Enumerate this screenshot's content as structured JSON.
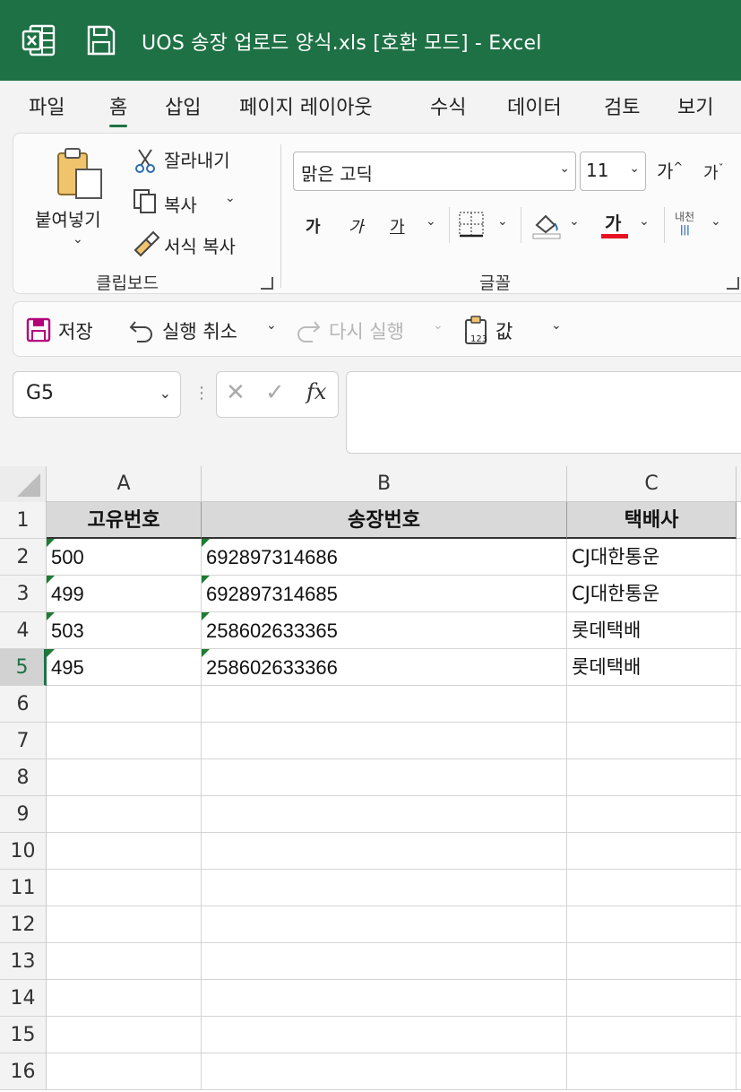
{
  "titlebar": {
    "title": "UOS 송장 업로드 양식.xls  [호환 모드]  -  Excel",
    "bg_color": "#1e7145"
  },
  "menu": {
    "tabs": [
      {
        "label": "파일"
      },
      {
        "label": "홈",
        "active": true
      },
      {
        "label": "삽입"
      },
      {
        "label": "페이지 레이아웃"
      },
      {
        "label": "수식"
      },
      {
        "label": "데이터"
      },
      {
        "label": "검토"
      },
      {
        "label": "보기"
      }
    ]
  },
  "ribbon": {
    "clipboard": {
      "paste_label": "붙여넣기",
      "cut_label": "잘라내기",
      "copy_label": "복사",
      "format_painter_label": "서식 복사",
      "group_label": "클립보드"
    },
    "font": {
      "font_name": "맑은 고딕",
      "font_size": "11",
      "grow_label": "가",
      "shrink_label": "가",
      "bold_label": "가",
      "italic_label": "가",
      "underline_label": "가",
      "font_color_label": "가",
      "phonetic_label": "내천",
      "group_label": "글꼴",
      "font_color": "#e81123"
    }
  },
  "qat": {
    "save_label": "저장",
    "undo_label": "실행 취소",
    "redo_label": "다시 실행",
    "paste_values_label": "값"
  },
  "formula_bar": {
    "name_box": "G5",
    "formula": ""
  },
  "sheet": {
    "columns": [
      "A",
      "B",
      "C"
    ],
    "row_numbers": [
      "1",
      "2",
      "3",
      "4",
      "5",
      "6",
      "7",
      "8",
      "9",
      "10",
      "11",
      "12",
      "13",
      "14",
      "15",
      "16"
    ],
    "selected_row": "5",
    "header_row": [
      "고유번호",
      "송장번호",
      "택배사"
    ],
    "rows": [
      [
        "500",
        "692897314686",
        "CJ대한통운"
      ],
      [
        "499",
        "692897314685",
        "CJ대한통운"
      ],
      [
        "503",
        "258602633365",
        "롯데택배"
      ],
      [
        "495",
        "258602633366",
        "롯데택배"
      ]
    ]
  }
}
